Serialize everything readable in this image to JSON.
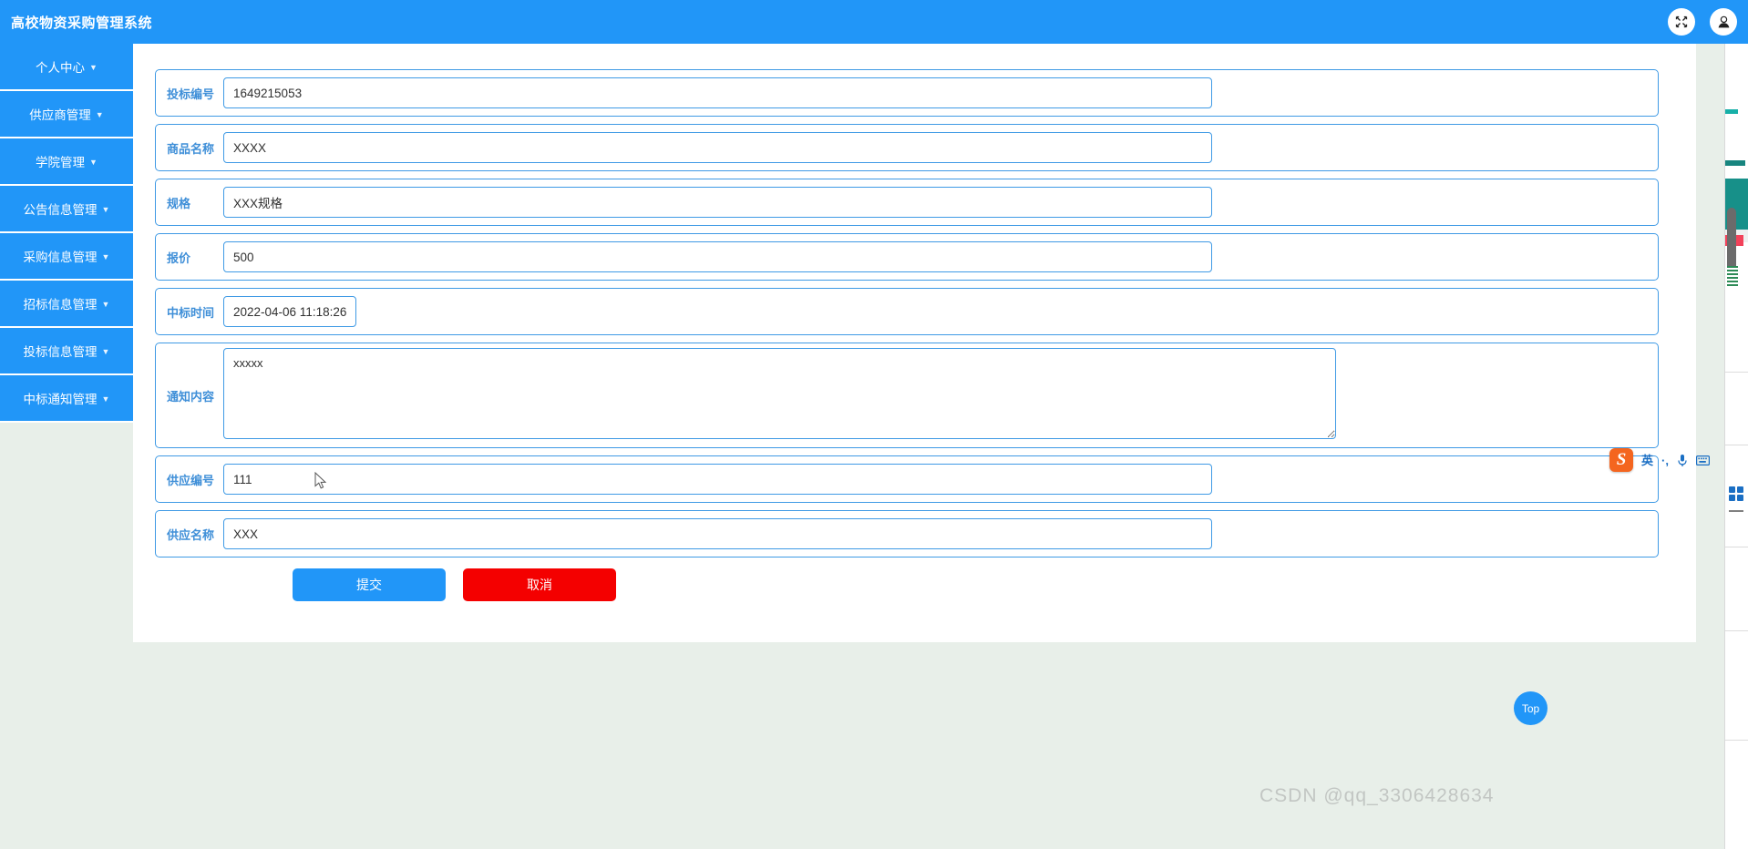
{
  "header": {
    "title": "高校物资采购管理系统",
    "fullscreen_icon": "fullscreen-icon",
    "user_icon": "user-icon"
  },
  "sidebar": {
    "items": [
      {
        "label": "个人中心",
        "caret": "▼"
      },
      {
        "label": "供应商管理",
        "caret": "▼"
      },
      {
        "label": "学院管理",
        "caret": "▼"
      },
      {
        "label": "公告信息管理",
        "caret": "▼"
      },
      {
        "label": "采购信息管理",
        "caret": "▼"
      },
      {
        "label": "招标信息管理",
        "caret": "▼"
      },
      {
        "label": "投标信息管理",
        "caret": "▼"
      },
      {
        "label": "中标通知管理",
        "caret": "▼"
      }
    ]
  },
  "form": {
    "fields": [
      {
        "label": "投标编号",
        "value": "1649215053",
        "type": "text"
      },
      {
        "label": "商品名称",
        "value": "XXXX",
        "type": "text"
      },
      {
        "label": "规格",
        "value": "XXX规格",
        "type": "text"
      },
      {
        "label": "报价",
        "value": "500",
        "type": "text"
      },
      {
        "label": "中标时间",
        "value": "2022-04-06 11:18:26",
        "type": "date"
      },
      {
        "label": "通知内容",
        "value": "xxxxx",
        "type": "textarea"
      },
      {
        "label": "供应编号",
        "value": "111",
        "type": "text"
      },
      {
        "label": "供应名称",
        "value": "XXX",
        "type": "text"
      }
    ],
    "submit_label": "提交",
    "cancel_label": "取消"
  },
  "ime": {
    "logo": "S",
    "mode_label": "英",
    "punctuation_label": "·,",
    "mic_icon": "microphone-icon",
    "keyboard_icon": "keyboard-icon",
    "apps_icon": "apps-grid-icon"
  },
  "footer": {
    "top_button_label": "Top",
    "watermark": "CSDN @qq_3306428634"
  },
  "colors": {
    "brand_blue": "#2196f8",
    "danger_red": "#f40000",
    "field_border": "#3f9ae5",
    "label_blue": "#3f8fd8",
    "page_bg": "#e8efe9"
  }
}
